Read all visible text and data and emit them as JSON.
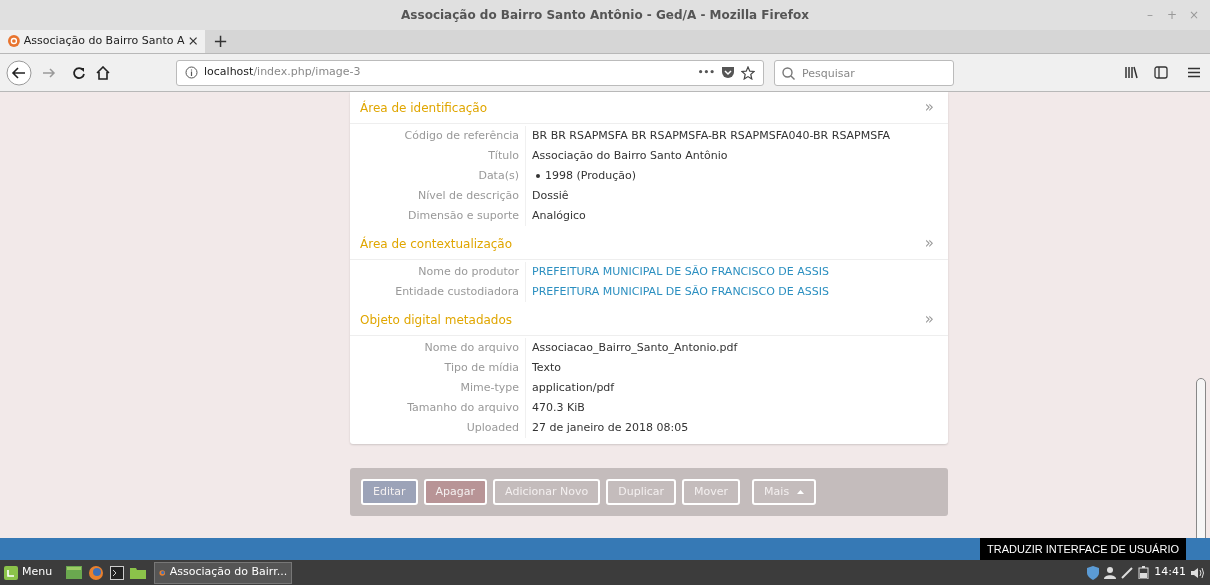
{
  "window": {
    "title": "Associação do Bairro Santo Antônio - Ged/A - Mozilla Firefox",
    "controls": [
      "–",
      "+",
      "×"
    ]
  },
  "tabs": [
    {
      "label": "Associação do Bairro Santo A",
      "selected": true
    }
  ],
  "new_tab": "+",
  "url": {
    "host": "localhost",
    "path": "/index.php/image-3"
  },
  "page_actions": "•••",
  "search": {
    "placeholder": "Pesquisar"
  },
  "sections": [
    {
      "title": "Área de identificação",
      "toggle": "»",
      "rows": [
        {
          "label": "Código de referência",
          "value": "BR BR RSAPMSFA BR RSAPMSFA-BR RSAPMSFA040-BR RSAPMSFA",
          "kind": "text"
        },
        {
          "label": "Título",
          "value": "Associação do Bairro Santo Antônio",
          "kind": "text"
        },
        {
          "label": "Data(s)",
          "value": "1998 (Produção)",
          "kind": "list"
        },
        {
          "label": "Nível de descrição",
          "value": "Dossiê",
          "kind": "text"
        },
        {
          "label": "Dimensão e suporte",
          "value": "Analógico",
          "kind": "text"
        }
      ]
    },
    {
      "title": "Área de contextualização",
      "toggle": "»",
      "rows": [
        {
          "label": "Nome do produtor",
          "value": "PREFEITURA MUNICIPAL DE SÃO FRANCISCO DE ASSIS",
          "kind": "link"
        },
        {
          "label": "Entidade custodiadora",
          "value": "PREFEITURA MUNICIPAL DE SÃO FRANCISCO DE ASSIS",
          "kind": "link"
        }
      ]
    },
    {
      "title": "Objeto digital metadados",
      "toggle": "»",
      "rows": [
        {
          "label": "Nome do arquivo",
          "value": "Associacao_Bairro_Santo_Antonio.pdf",
          "kind": "text"
        },
        {
          "label": "Tipo de mídia",
          "value": "Texto",
          "kind": "text"
        },
        {
          "label": "Mime-type",
          "value": "application/pdf",
          "kind": "text"
        },
        {
          "label": "Tamanho do arquivo",
          "value": "470.3 KiB",
          "kind": "text"
        },
        {
          "label": "Uploaded",
          "value": "27 de janeiro de 2018 08:05",
          "kind": "text"
        }
      ]
    }
  ],
  "actions": [
    {
      "label": "Editar",
      "kind": "primary"
    },
    {
      "label": "Apagar",
      "kind": "danger"
    },
    {
      "label": "Adicionar Novo",
      "kind": "default"
    },
    {
      "label": "Duplicar",
      "kind": "default"
    },
    {
      "label": "Mover",
      "kind": "default"
    },
    {
      "label": "Mais",
      "kind": "dropdown"
    }
  ],
  "translate_button": "TRADUZIR INTERFACE DE USUÁRIO",
  "taskbar": {
    "menu": "Menu",
    "window": "Associação do Bairr...",
    "clock": "14:41"
  }
}
